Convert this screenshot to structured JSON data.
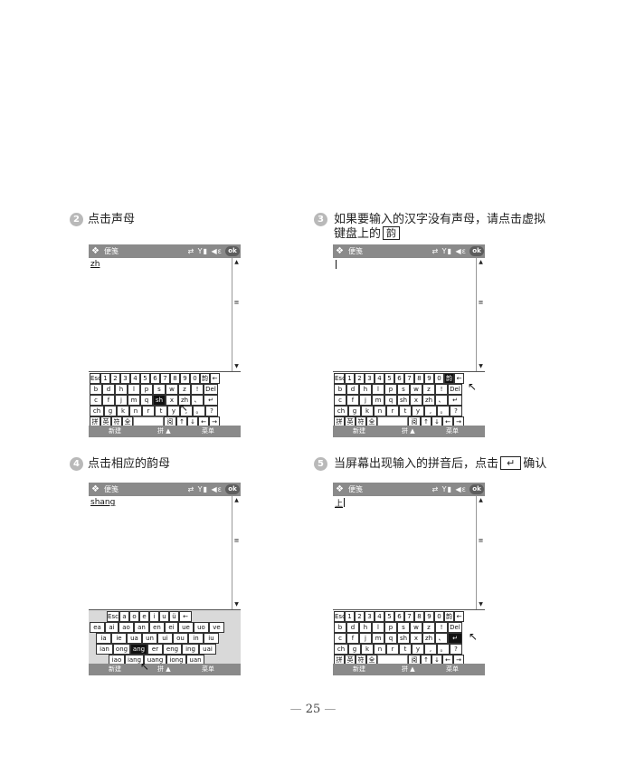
{
  "steps": [
    {
      "num": "2",
      "text": "点击声母"
    },
    {
      "num": "3",
      "line1": "如果要输入的汉字没有声母，请点击虚拟",
      "line2_prefix": "键盘上的",
      "key": "韵"
    },
    {
      "num": "4",
      "text": "点击相应的韵母"
    },
    {
      "num": "5",
      "prefix": "当屏幕出现输入的拼音后，点击",
      "key": "↵",
      "suffix": "确认"
    }
  ],
  "device": {
    "title": "便笺",
    "status_icons": "⇄ Y▮ ◀ε",
    "ok_label": "ok",
    "menu": {
      "left": "新建",
      "middle": "拼 ▲",
      "right": "菜单"
    },
    "scroll_up": "▲",
    "scroll_grip": "≡",
    "scroll_down": "▼"
  },
  "screens": [
    {
      "text": "zh",
      "highlight": "sh"
    },
    {
      "text": "",
      "highlight": "韵"
    },
    {
      "text": "shang",
      "highlight": "ang"
    },
    {
      "text": "上",
      "highlight": "↵"
    }
  ],
  "keyboard": {
    "row1": [
      "Esc",
      "1",
      "2",
      "3",
      "4",
      "5",
      "6",
      "7",
      "8",
      "9",
      "0",
      "韵",
      "←"
    ],
    "row2": [
      "b",
      "d",
      "h",
      "l",
      "p",
      "s",
      "w",
      "z",
      "!",
      "Del"
    ],
    "row3": [
      "c",
      "f",
      "j",
      "m",
      "q",
      "sh",
      "x",
      "zh",
      "、",
      "↵"
    ],
    "row4": [
      "ch",
      "g",
      "k",
      "n",
      "r",
      "t",
      "y",
      ",",
      "。",
      "?"
    ],
    "row5": [
      "拼",
      "英",
      "符",
      "全",
      "",
      "阅",
      "↑",
      "↓",
      "←",
      "→"
    ]
  },
  "finals_keyboard": {
    "row1": [
      "Esc",
      "a",
      "o",
      "e",
      "i",
      "u",
      "ü",
      "←"
    ],
    "row2": [
      "ea",
      "ai",
      "ao",
      "an",
      "en",
      "ei",
      "ue",
      "uo",
      "ve"
    ],
    "row3": [
      "ia",
      "ie",
      "ua",
      "un",
      "ui",
      "ou",
      "in",
      "iu"
    ],
    "row4": [
      "ian",
      "ong",
      "ang",
      "er",
      "eng",
      "ing",
      "uai"
    ],
    "row5": [
      "iao",
      "iang",
      "uang",
      "iong",
      "uan"
    ]
  },
  "page_number": "25",
  "page_dash": "—"
}
